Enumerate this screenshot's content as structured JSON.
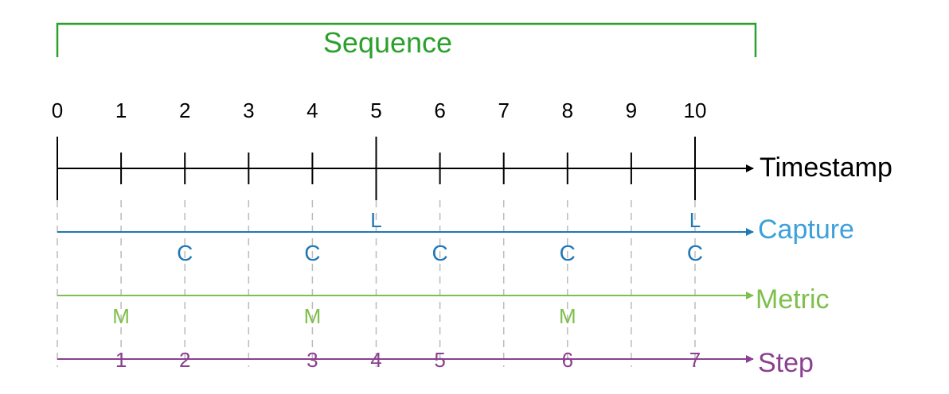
{
  "sequence": {
    "label": "Sequence",
    "color": "#2ca02c"
  },
  "timestamp": {
    "label": "Timestamp",
    "ticks": [
      "0",
      "1",
      "2",
      "3",
      "4",
      "5",
      "6",
      "7",
      "8",
      "9",
      "10"
    ],
    "major_ticks": [
      0,
      5,
      10
    ],
    "color": "#000000"
  },
  "capture": {
    "label": "Capture",
    "line_color": "#1f77b4",
    "label_color": "#3ca0dc",
    "l_marker": "L",
    "c_marker": "C",
    "l_positions": [
      5,
      10
    ],
    "c_positions": [
      2,
      4,
      6,
      8,
      10
    ]
  },
  "metric": {
    "label": "Metric",
    "color": "#7fbf4c",
    "marker": "M",
    "positions": [
      1,
      4,
      8
    ]
  },
  "step": {
    "label": "Step",
    "color": "#8b3f8f",
    "steps": [
      {
        "at": 1,
        "label": "1"
      },
      {
        "at": 2,
        "label": "2"
      },
      {
        "at": 4,
        "label": "3"
      },
      {
        "at": 5,
        "label": "4"
      },
      {
        "at": 6,
        "label": "5"
      },
      {
        "at": 8,
        "label": "6"
      },
      {
        "at": 10,
        "label": "7"
      }
    ]
  },
  "guide_color": "#bbbbbb"
}
